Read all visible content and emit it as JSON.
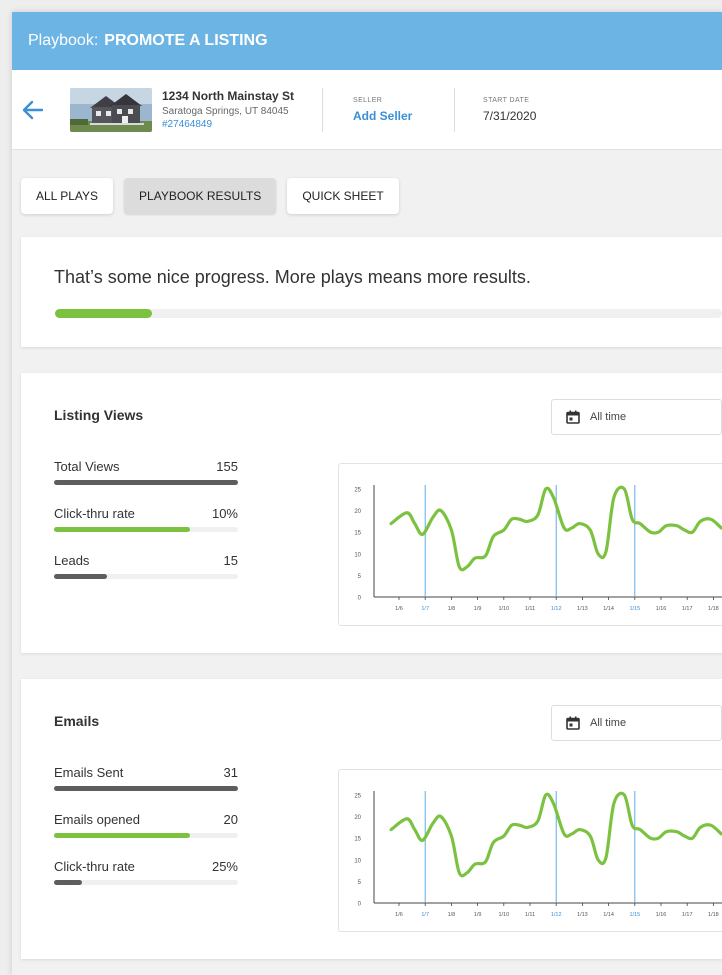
{
  "header": {
    "prefix": "Playbook:",
    "title": "PROMOTE A LISTING"
  },
  "listing": {
    "street": "1234 North Mainstay St",
    "city": "Saratoga Springs, UT 84045",
    "mls": "#27464849",
    "seller_label": "SELLER",
    "seller_value": "Add Seller",
    "start_label": "START DATE",
    "start_value": "7/31/2020"
  },
  "tabs": [
    {
      "label": "ALL PLAYS",
      "active": false
    },
    {
      "label": "PLAYBOOK RESULTS",
      "active": true
    },
    {
      "label": "QUICK SHEET",
      "active": false
    }
  ],
  "progress": {
    "message": "That’s some nice progress. More plays means more results.",
    "percent": 14.5
  },
  "colors": {
    "accent": "#6cb4e4",
    "green": "#7cc240",
    "link": "#3a8fd6",
    "dark_bar": "#5d5d5d"
  },
  "listing_views": {
    "title": "Listing Views",
    "range": "All time",
    "stats": [
      {
        "label": "Total Views",
        "value": "155",
        "fill": 100,
        "color": "dark"
      },
      {
        "label": "Click-thru rate",
        "value": "10%",
        "fill": 74,
        "color": "green"
      },
      {
        "label": "Leads",
        "value": "15",
        "fill": 29,
        "color": "dark"
      }
    ]
  },
  "emails": {
    "title": "Emails",
    "range": "All time",
    "stats": [
      {
        "label": "Emails Sent",
        "value": "31",
        "fill": 100,
        "color": "dark"
      },
      {
        "label": "Emails opened",
        "value": "20",
        "fill": 74,
        "color": "green"
      },
      {
        "label": "Click-thru rate",
        "value": "25%",
        "fill": 15,
        "color": "dark"
      }
    ]
  },
  "chart_data": [
    {
      "type": "line",
      "ylim": [
        0,
        25
      ],
      "y_ticks": [
        "0",
        "5",
        "10",
        "15",
        "20",
        "25"
      ],
      "categories": [
        "1/6",
        "1/7",
        "1/8",
        "1/9",
        "1/10",
        "1/11",
        "1/12",
        "1/13",
        "1/14",
        "1/15",
        "1/16",
        "1/17",
        "1/18"
      ],
      "highlighted": [
        "1/7",
        "1/12",
        "1/15"
      ],
      "series": [
        {
          "x": [
            5.7,
            6.3,
            6.6,
            6.9,
            7.3,
            7.6,
            8.0,
            8.3,
            8.6,
            8.9,
            9.3,
            9.6,
            10.0,
            10.3,
            10.6,
            10.9,
            11.3,
            11.6,
            11.9,
            12.3,
            12.6,
            12.9,
            13.3,
            13.6,
            13.9,
            14.2,
            14.6,
            14.9,
            15.2,
            15.6,
            15.9,
            16.2,
            16.6,
            16.9,
            17.2,
            17.5,
            17.9,
            18.3
          ],
          "y": [
            17,
            19.5,
            17,
            14.5,
            18.5,
            20,
            15.5,
            7,
            7,
            9,
            9.5,
            14,
            15.5,
            18,
            18,
            17.5,
            19,
            25,
            23,
            16,
            16,
            17,
            15.5,
            10,
            10.5,
            23,
            25,
            18,
            17,
            15,
            15,
            16.5,
            16.5,
            15.5,
            15,
            17.5,
            18,
            16
          ]
        }
      ]
    },
    {
      "type": "line",
      "ylim": [
        0,
        25
      ],
      "y_ticks": [
        "0",
        "5",
        "10",
        "15",
        "20",
        "25"
      ],
      "categories": [
        "1/6",
        "1/7",
        "1/8",
        "1/9",
        "1/10",
        "1/11",
        "1/12",
        "1/13",
        "1/14",
        "1/15",
        "1/16",
        "1/17",
        "1/18"
      ],
      "highlighted": [
        "1/7",
        "1/12",
        "1/15"
      ],
      "series": [
        {
          "x": [
            5.7,
            6.3,
            6.6,
            6.9,
            7.3,
            7.6,
            8.0,
            8.3,
            8.6,
            8.9,
            9.3,
            9.6,
            10.0,
            10.3,
            10.6,
            10.9,
            11.3,
            11.6,
            11.9,
            12.3,
            12.6,
            12.9,
            13.3,
            13.6,
            13.9,
            14.2,
            14.6,
            14.9,
            15.2,
            15.6,
            15.9,
            16.2,
            16.6,
            16.9,
            17.2,
            17.5,
            17.9,
            18.3
          ],
          "y": [
            17,
            19.5,
            17,
            14.5,
            18.5,
            20,
            15.5,
            7,
            7,
            9,
            9.5,
            14,
            15.5,
            18,
            18,
            17.5,
            19,
            25,
            23,
            16,
            16,
            17,
            15.5,
            10,
            10.5,
            23,
            25,
            18,
            17,
            15,
            15,
            16.5,
            16.5,
            15.5,
            15,
            17.5,
            18,
            16
          ]
        }
      ]
    }
  ]
}
